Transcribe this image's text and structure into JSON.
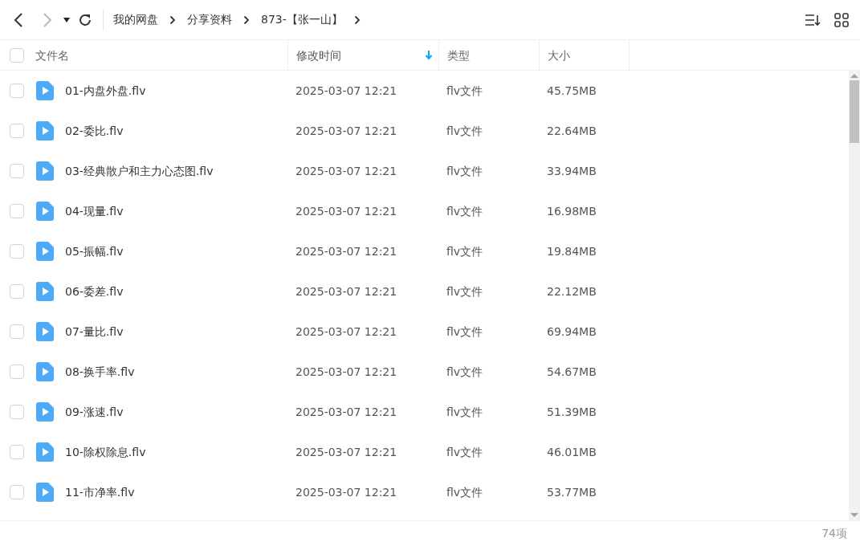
{
  "breadcrumbs": [
    "我的网盘",
    "分享资料",
    "873-【张一山】"
  ],
  "columns": [
    {
      "label": "文件名",
      "sorted": false
    },
    {
      "label": "修改时间",
      "sorted": true
    },
    {
      "label": "类型",
      "sorted": false
    },
    {
      "label": "大小",
      "sorted": false
    }
  ],
  "select_all": {
    "checked": false
  },
  "rows": [
    {
      "name": "01-内盘外盘.flv",
      "modified": "2025-03-07 12:21",
      "type": "flv文件",
      "size": "45.75MB",
      "checked": false
    },
    {
      "name": "02-委比.flv",
      "modified": "2025-03-07 12:21",
      "type": "flv文件",
      "size": "22.64MB",
      "checked": false
    },
    {
      "name": "03-经典散户和主力心态图.flv",
      "modified": "2025-03-07 12:21",
      "type": "flv文件",
      "size": "33.94MB",
      "checked": false
    },
    {
      "name": "04-现量.flv",
      "modified": "2025-03-07 12:21",
      "type": "flv文件",
      "size": "16.98MB",
      "checked": false
    },
    {
      "name": "05-振幅.flv",
      "modified": "2025-03-07 12:21",
      "type": "flv文件",
      "size": "19.84MB",
      "checked": false
    },
    {
      "name": "06-委差.flv",
      "modified": "2025-03-07 12:21",
      "type": "flv文件",
      "size": "22.12MB",
      "checked": false
    },
    {
      "name": "07-量比.flv",
      "modified": "2025-03-07 12:21",
      "type": "flv文件",
      "size": "69.94MB",
      "checked": false
    },
    {
      "name": "08-换手率.flv",
      "modified": "2025-03-07 12:21",
      "type": "flv文件",
      "size": "54.67MB",
      "checked": false
    },
    {
      "name": "09-涨速.flv",
      "modified": "2025-03-07 12:21",
      "type": "flv文件",
      "size": "51.39MB",
      "checked": false
    },
    {
      "name": "10-除权除息.flv",
      "modified": "2025-03-07 12:21",
      "type": "flv文件",
      "size": "46.01MB",
      "checked": false
    },
    {
      "name": "11-市净率.flv",
      "modified": "2025-03-07 12:21",
      "type": "flv文件",
      "size": "53.77MB",
      "checked": false
    }
  ],
  "status_bar": {
    "count": "74项"
  }
}
